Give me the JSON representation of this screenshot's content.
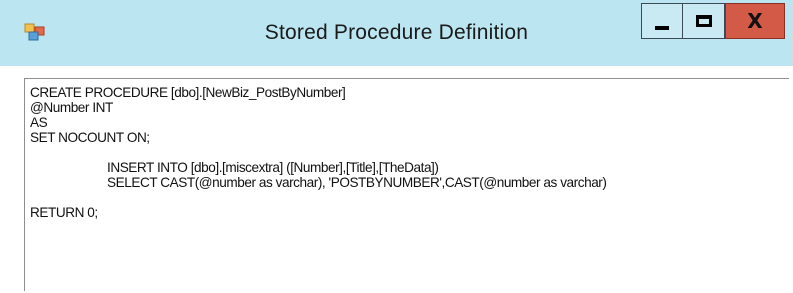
{
  "window": {
    "title": "Stored Procedure Definition",
    "controls": {
      "minimize": "minimize",
      "maximize": "maximize",
      "close": "close"
    },
    "close_color": "#d25a47",
    "titlebar_color": "#bbe5f0"
  },
  "editor": {
    "lines": [
      {
        "text": "CREATE PROCEDURE [dbo].[NewBiz_PostByNumber]",
        "indent": false
      },
      {
        "text": "@Number INT",
        "indent": false
      },
      {
        "text": "AS",
        "indent": false
      },
      {
        "text": "SET NOCOUNT ON;",
        "indent": false
      },
      {
        "text": "",
        "indent": false
      },
      {
        "text": "INSERT INTO [dbo].[miscextra] ([Number],[Title],[TheData])",
        "indent": true
      },
      {
        "text": "SELECT CAST(@number as varchar), 'POSTBYNUMBER',CAST(@number as varchar)",
        "indent": true
      },
      {
        "text": "",
        "indent": false
      },
      {
        "text": "RETURN 0;",
        "indent": false
      }
    ]
  }
}
